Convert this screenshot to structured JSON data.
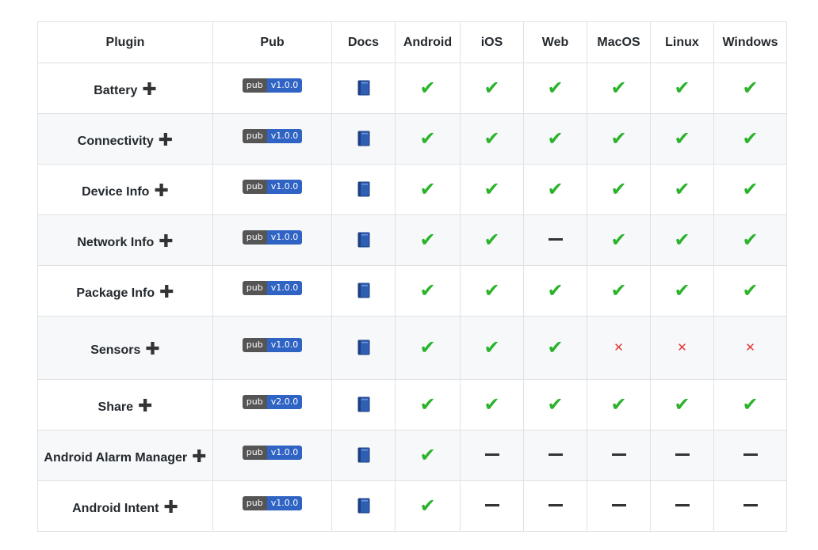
{
  "header": {
    "plugin": "Plugin",
    "pub": "Pub",
    "docs": "Docs",
    "platforms": [
      "Android",
      "iOS",
      "Web",
      "MacOS",
      "Linux",
      "Windows"
    ]
  },
  "badge_label": "pub",
  "symbols": {
    "check": "✔",
    "cross": "✕",
    "plus": "✚"
  },
  "rows": [
    {
      "name": "Battery",
      "version": "v1.0.0",
      "support": [
        "check",
        "check",
        "check",
        "check",
        "check",
        "check"
      ]
    },
    {
      "name": "Connectivity",
      "version": "v1.0.0",
      "support": [
        "check",
        "check",
        "check",
        "check",
        "check",
        "check"
      ]
    },
    {
      "name": "Device Info",
      "version": "v1.0.0",
      "support": [
        "check",
        "check",
        "check",
        "check",
        "check",
        "check"
      ]
    },
    {
      "name": "Network Info",
      "version": "v1.0.0",
      "support": [
        "check",
        "check",
        "dash",
        "check",
        "check",
        "check"
      ]
    },
    {
      "name": "Package Info",
      "version": "v1.0.0",
      "support": [
        "check",
        "check",
        "check",
        "check",
        "check",
        "check"
      ]
    },
    {
      "name": "Sensors",
      "version": "v1.0.0",
      "tall": true,
      "support": [
        "check",
        "check",
        "check",
        "cross",
        "cross",
        "cross"
      ]
    },
    {
      "name": "Share",
      "version": "v2.0.0",
      "support": [
        "check",
        "check",
        "check",
        "check",
        "check",
        "check"
      ]
    },
    {
      "name": "Android Alarm Manager",
      "version": "v1.0.0",
      "support": [
        "check",
        "dash",
        "dash",
        "dash",
        "dash",
        "dash"
      ]
    },
    {
      "name": "Android Intent",
      "version": "v1.0.0",
      "support": [
        "check",
        "dash",
        "dash",
        "dash",
        "dash",
        "dash"
      ]
    }
  ],
  "colors": {
    "check": "#2bb32b",
    "cross": "#e53935",
    "badge_left": "#555555",
    "badge_right": "#2f63c4",
    "book": "#2f5fb3"
  }
}
